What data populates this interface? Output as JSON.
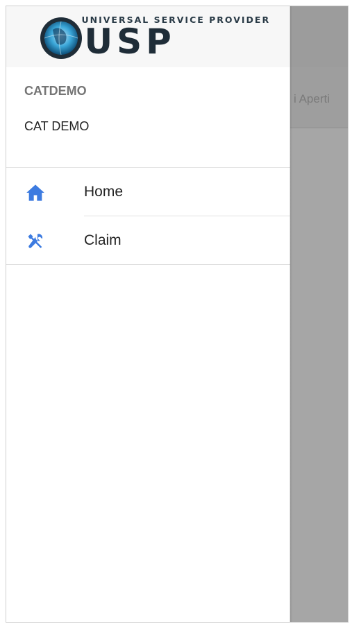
{
  "app": {
    "logo": {
      "tagline": "UNIVERSAL SERVICE PROVIDER",
      "wordmark": "USP"
    }
  },
  "user": {
    "id": "CATDEMO",
    "name": "CAT DEMO"
  },
  "menu": {
    "items": [
      {
        "label": "Home",
        "icon": "home-icon"
      },
      {
        "label": "Claim",
        "icon": "tools-icon"
      }
    ]
  },
  "background": {
    "tab_label": "i Aperti"
  },
  "colors": {
    "accent": "#3d7be0",
    "overlay": "#a6a6a6",
    "logo_dark": "#1f2d38"
  }
}
